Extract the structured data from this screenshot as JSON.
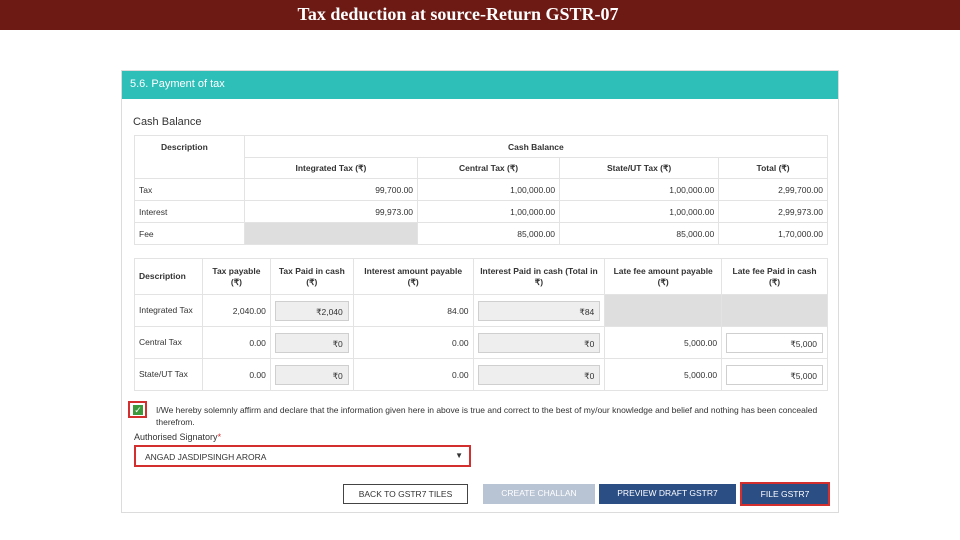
{
  "slide": {
    "title": "Tax deduction at source-Return GSTR-07"
  },
  "panel": {
    "title": "5.6. Payment of tax"
  },
  "cash_balance": {
    "label": "Cash Balance",
    "desc_header": "Description",
    "group_header": "Cash Balance",
    "columns": [
      "Integrated Tax (₹)",
      "Central Tax (₹)",
      "State/UT Tax (₹)",
      "Total (₹)"
    ],
    "rows": [
      {
        "desc": "Tax",
        "igst": "99,700.00",
        "cgst": "1,00,000.00",
        "sgst": "1,00,000.00",
        "total": "2,99,700.00"
      },
      {
        "desc": "Interest",
        "igst": "99,973.00",
        "cgst": "1,00,000.00",
        "sgst": "1,00,000.00",
        "total": "2,99,973.00"
      },
      {
        "desc": "Fee",
        "igst": "",
        "cgst": "85,000.00",
        "sgst": "85,000.00",
        "total": "1,70,000.00"
      }
    ]
  },
  "payment": {
    "headers": [
      "Description",
      "Tax payable (₹)",
      "Tax Paid in cash (₹)",
      "Interest amount payable (₹)",
      "Interest Paid in cash (Total in ₹)",
      "Late fee amount payable (₹)",
      "Late fee Paid in cash (₹)"
    ],
    "rows": [
      {
        "desc": "Integrated Tax",
        "tax_payable": "2,040.00",
        "tax_paid": "₹2,040",
        "interest_payable": "84.00",
        "interest_paid": "₹84",
        "late_fee_payable": "",
        "late_fee_paid": ""
      },
      {
        "desc": "Central Tax",
        "tax_payable": "0.00",
        "tax_paid": "₹0",
        "interest_payable": "0.00",
        "interest_paid": "₹0",
        "late_fee_payable": "5,000.00",
        "late_fee_paid": "₹5,000"
      },
      {
        "desc": "State/UT Tax",
        "tax_payable": "0.00",
        "tax_paid": "₹0",
        "interest_payable": "0.00",
        "interest_paid": "₹0",
        "late_fee_payable": "5,000.00",
        "late_fee_paid": "₹5,000"
      }
    ]
  },
  "declaration": {
    "checked": true,
    "text": "I/We hereby solemnly affirm and declare that the information given here in above is true and correct to the best of my/our knowledge and belief and nothing has been concealed therefrom."
  },
  "signatory": {
    "label": "Authorised Signatory",
    "required_mark": "*",
    "selected": "ANGAD JASDIPSINGH ARORA"
  },
  "buttons": {
    "back": "BACK TO GSTR7 TILES",
    "challan": "CREATE CHALLAN",
    "preview": "PREVIEW DRAFT GSTR7",
    "file": "FILE GSTR7"
  },
  "colors": {
    "header_bg": "#6e1a14",
    "panel_head": "#2ebfb9",
    "primary_button": "#2b4e85",
    "disabled_button": "#b8c3d3",
    "highlight": "#d32f2f",
    "checkbox": "#3c9a3c"
  },
  "icons": {
    "check": "check-icon",
    "dropdown": "chevron-down-icon"
  }
}
